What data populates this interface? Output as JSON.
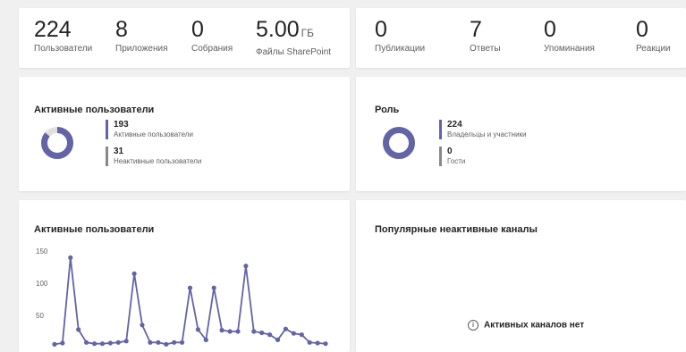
{
  "top_metrics_left": [
    {
      "value": "224",
      "unit": "",
      "label": "Пользователи"
    },
    {
      "value": "8",
      "unit": "",
      "label": "Приложения"
    },
    {
      "value": "0",
      "unit": "",
      "label": "Собрания"
    },
    {
      "value": "5.00",
      "unit": "ГБ",
      "label": "Файлы SharePoint"
    }
  ],
  "top_metrics_right": [
    {
      "value": "0",
      "label": "Публикации"
    },
    {
      "value": "7",
      "label": "Ответы"
    },
    {
      "value": "0",
      "label": "Упоминания"
    },
    {
      "value": "0",
      "label": "Реакции"
    }
  ],
  "active_users_card": {
    "title": "Активные пользователи",
    "items": [
      {
        "value": "193",
        "label": "Активные пользователи"
      },
      {
        "value": "31",
        "label": "Неактивные пользователи"
      }
    ],
    "active_fraction": 0.862
  },
  "role_card": {
    "title": "Роль",
    "items": [
      {
        "value": "224",
        "label": "Владельцы и участники"
      },
      {
        "value": "0",
        "label": "Гости"
      }
    ],
    "owner_fraction": 1.0
  },
  "chart_card": {
    "title": "Активные пользователи"
  },
  "inactive_channels_card": {
    "title": "Популярные неактивные каналы",
    "empty_text": "Активных каналов нет",
    "info_glyph": "i"
  },
  "colors": {
    "accent": "#6264a7",
    "muted": "#8a8886",
    "ring_bg": "#e1dfdd"
  },
  "chart_data": {
    "type": "line",
    "title": "",
    "xlabel": "",
    "ylabel": "",
    "yticks": [
      150,
      100,
      50
    ],
    "ylim": [
      0,
      160
    ],
    "x": [
      1,
      2,
      3,
      4,
      5,
      6,
      7,
      8,
      9,
      10,
      11,
      12,
      13,
      14,
      15,
      16,
      17,
      18,
      19,
      20,
      21,
      22,
      23,
      24,
      25,
      26,
      27,
      28,
      29,
      30,
      31,
      32,
      33,
      34,
      35
    ],
    "values": [
      5,
      7,
      140,
      28,
      8,
      6,
      6,
      7,
      8,
      10,
      115,
      35,
      8,
      8,
      5,
      8,
      8,
      93,
      28,
      12,
      93,
      27,
      25,
      25,
      127,
      25,
      23,
      20,
      12,
      29,
      22,
      20,
      8,
      7,
      6
    ],
    "series": [
      {
        "values": [
          5,
          7,
          140,
          28,
          8,
          6,
          6,
          7,
          8,
          10,
          115,
          35,
          8,
          8,
          5,
          8,
          8,
          93,
          28,
          12,
          93,
          27,
          25,
          25,
          127,
          25,
          23,
          20,
          12,
          29,
          22,
          20,
          8,
          7,
          6
        ]
      }
    ]
  }
}
